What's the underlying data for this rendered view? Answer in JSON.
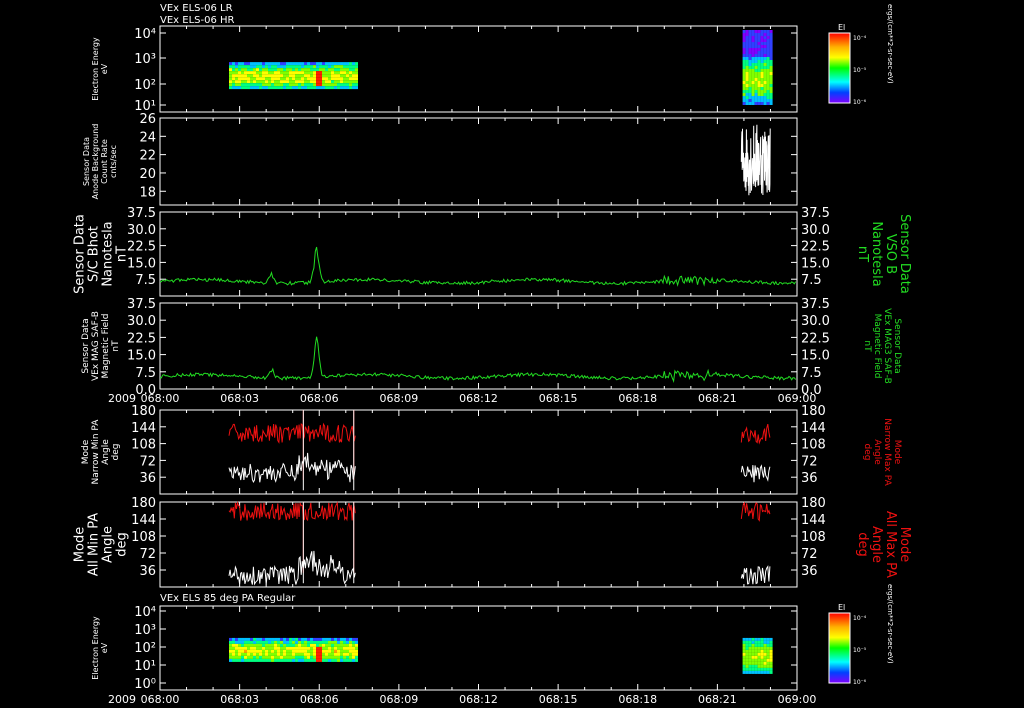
{
  "header_lines": [
    "VEx ELS-06 LR",
    "VEx ELS-06 HR"
  ],
  "mid_title": "VEx ELS 85 deg PA Regular",
  "year": "2009",
  "time_ticks": [
    "068:00",
    "068:03",
    "068:06",
    "068:09",
    "068:12",
    "068:15",
    "068:18",
    "068:21",
    "069:00"
  ],
  "colorbar": {
    "title": "El",
    "units": "ergs/(cm**2-sr-sec-eV)",
    "tick_labels": [
      "10⁻⁴",
      "10⁻⁵",
      "10⁻⁶"
    ]
  },
  "colors": {
    "white": "#ffffff",
    "green": "#22dd22",
    "red": "#ee1111"
  },
  "chart_data": [
    {
      "id": "electron-energy-lr-hr",
      "type": "heatmap",
      "ylabel": [
        "Electron Energy",
        "eV"
      ],
      "y_tick_labels": [
        "10⁴",
        "10³",
        "10²",
        "10¹"
      ],
      "ylim_exponent": [
        0,
        4
      ],
      "log_scale": true,
      "data_segments": [
        [
          "068:03",
          "068:07"
        ],
        [
          "068:21:30",
          "068:23"
        ]
      ]
    },
    {
      "id": "sensor-background",
      "type": "line",
      "ylabel": [
        "Sensor Data",
        "Anode Background",
        "Count Rate",
        "cnts/sec"
      ],
      "y_tick_labels": [
        "26",
        "24",
        "22",
        "20",
        "18"
      ],
      "ylim": [
        16.5,
        26
      ],
      "series": [
        {
          "color": "white",
          "mean": 22.5,
          "range": [
            17.5,
            25.5
          ],
          "x_range": [
            21.9,
            23
          ]
        }
      ]
    },
    {
      "id": "sc-bhot",
      "type": "line",
      "ylabel": [
        "Sensor Data",
        "S/C Bhot",
        "Nanotesla",
        "nT"
      ],
      "right_label": [
        "Sensor Data",
        "VSO B",
        "Nanotesla",
        "nT"
      ],
      "y_tick_labels": [
        "37.5",
        "30.0",
        "22.5",
        "15.0",
        "7.5"
      ],
      "ylim": [
        0,
        37.5
      ],
      "series": [
        {
          "color": "green",
          "baseline": 6.5,
          "peaks": [
            [
              4.2,
              12
            ],
            [
              5.9,
              26
            ]
          ]
        }
      ]
    },
    {
      "id": "mag-saf-b",
      "type": "line",
      "ylabel": [
        "Sensor Data",
        "VEx MAG SAF-B",
        "Magnetic Field",
        "nT"
      ],
      "right_label": [
        "Sensor Data",
        "VEx MAG3 SAF-B",
        "Magnetic Field",
        "nT"
      ],
      "y_tick_labels": [
        "37.5",
        "30.0",
        "22.5",
        "15.0",
        "7.5",
        "0.0"
      ],
      "ylim": [
        0,
        37.5
      ],
      "series": [
        {
          "color": "green",
          "baseline": 5.5,
          "peaks": [
            [
              4.2,
              10
            ],
            [
              5.9,
              26
            ]
          ]
        }
      ]
    },
    {
      "id": "narrow-pa",
      "type": "line",
      "ylabel": [
        "Mode",
        "Narrow Min PA",
        "Angle",
        "deg"
      ],
      "right_label": [
        "Mode",
        "Narrow Max PA",
        "Angle",
        "deg"
      ],
      "y_tick_labels": [
        "180",
        "144",
        "108",
        "72",
        "36"
      ],
      "ylim": [
        0,
        180
      ],
      "series": [
        {
          "name": "Max PA",
          "color": "red",
          "segments": [
            [
              2.6,
              7.4
            ],
            [
              21.9,
              23
            ]
          ],
          "level": 130
        },
        {
          "name": "Min PA",
          "color": "white",
          "segments": [
            [
              2.6,
              7.4
            ],
            [
              21.9,
              23
            ]
          ],
          "level": 45
        }
      ]
    },
    {
      "id": "all-pa",
      "type": "line",
      "ylabel": [
        "Mode",
        "All Min PA",
        "Angle",
        "deg"
      ],
      "right_label": [
        "Mode",
        "All Max PA",
        "Angle",
        "deg"
      ],
      "y_tick_labels": [
        "180",
        "144",
        "108",
        "72",
        "36"
      ],
      "ylim": [
        0,
        180
      ],
      "series": [
        {
          "name": "Max PA",
          "color": "red",
          "segments": [
            [
              2.6,
              7.4
            ],
            [
              21.9,
              23
            ]
          ],
          "level": 160
        },
        {
          "name": "Min PA",
          "color": "white",
          "segments": [
            [
              2.6,
              7.4
            ],
            [
              21.9,
              23
            ]
          ],
          "level": 25
        }
      ]
    },
    {
      "id": "electron-energy-85",
      "type": "heatmap",
      "ylabel": [
        "Electron Energy",
        "eV"
      ],
      "y_tick_labels": [
        "10⁴",
        "10³",
        "10²",
        "10¹",
        "10⁰"
      ],
      "ylim_exponent": [
        -0.5,
        4
      ],
      "log_scale": true,
      "data_segments": [
        [
          "068:03",
          "068:07"
        ],
        [
          "068:21:30",
          "068:23"
        ]
      ]
    }
  ]
}
